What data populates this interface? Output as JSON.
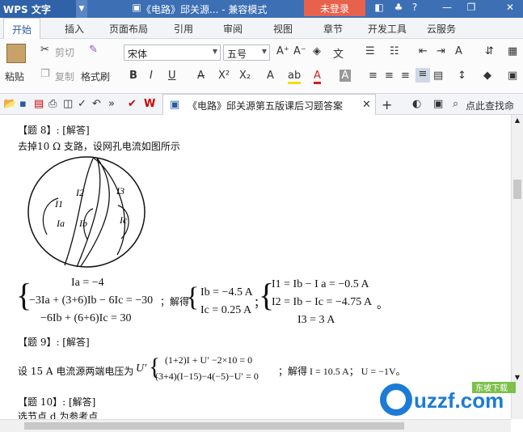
{
  "titlebar": {
    "app_name": "WPS 文字",
    "doc_title": "《电路》邱关源... - 兼容模式",
    "login": "未登录",
    "help": "?"
  },
  "tabs": [
    "开始",
    "插入",
    "页面布局",
    "引用",
    "审阅",
    "视图",
    "章节",
    "开发工具",
    "云服务"
  ],
  "ribbon": {
    "cut": "剪切",
    "copy": "复制",
    "paste": "粘贴",
    "format_painter": "格式刷",
    "font": "宋体",
    "size": "五号",
    "bold": "B",
    "italic": "I",
    "underline": "U",
    "sup": "X²",
    "sub": "X₂",
    "font_color": "A"
  },
  "quickaccess": {
    "doc_tab": "《电路》邱关源第五版课后习题答案",
    "search": "点此查找命令"
  },
  "content": {
    "q8_head": "【题 8】: [解答]",
    "q8_text": "去掉10 Ω 支路，设网孔电流如图所示",
    "diagram": {
      "labels": [
        "I1",
        "I2",
        "I3",
        "Ia",
        "Ib",
        "Ic"
      ]
    },
    "eq8": {
      "left": [
        "Ia = −4",
        "−3Ia + (3+6)Ib − 6Ic = −30",
        "−6Ib + (6+6)Ic = 30"
      ],
      "solve": "；解得",
      "mid": [
        "Ib = −4.5 A",
        "Ic = 0.25 A"
      ],
      "semicolon": "；",
      "right": [
        "I1 = Ib − I a = −0.5 A",
        "I2 = Ib − Ic = −4.75 A",
        "I3 = 3 A"
      ],
      "end": "。"
    },
    "q9_head": "【题 9】: [解答]",
    "q9_text": "设 15 A 电流源两端电压为",
    "q9_var": "U′",
    "eq9": [
      "(1+2)I + U′ −2×10 = 0",
      "(3+4)(I−15)−4(−5)−U′ = 0"
    ],
    "q9_result": "；解得 I = 10.5 A；  U = −1V。",
    "q10_head": "【题 10】: [解答]",
    "q10_text": "选节点 d 为参考点"
  },
  "watermark": {
    "text": "uzzf.com",
    "sub": "东坡下载"
  }
}
